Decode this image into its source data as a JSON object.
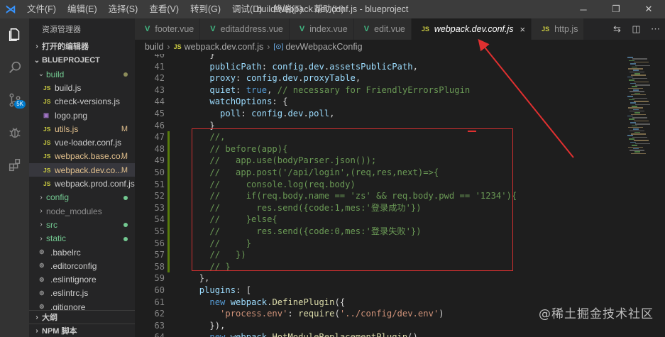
{
  "window": {
    "title": "build\\webpack.dev.conf.js - blueproject",
    "menu": [
      "文件(F)",
      "编辑(E)",
      "选择(S)",
      "查看(V)",
      "转到(G)",
      "调试(D)",
      "终端(T)",
      "帮助(H)"
    ],
    "controls": [
      "─",
      "❐",
      "✕"
    ]
  },
  "activity_bar": {
    "items": [
      "explorer-icon",
      "search-icon",
      "source-control-icon",
      "debug-icon",
      "extensions-icon"
    ],
    "scm_badge": "5K"
  },
  "sidebar": {
    "title": "资源管理器",
    "open_editors": "打开的编辑器",
    "project": "BLUEPROJECT",
    "tree": [
      {
        "name": "build",
        "type": "folder",
        "open": true,
        "depth": 1,
        "status": "dot"
      },
      {
        "name": "build.js",
        "type": "js",
        "depth": 2
      },
      {
        "name": "check-versions.js",
        "type": "js",
        "depth": 2
      },
      {
        "name": "logo.png",
        "type": "png",
        "depth": 2
      },
      {
        "name": "utils.js",
        "type": "js",
        "depth": 2,
        "status": "M"
      },
      {
        "name": "vue-loader.conf.js",
        "type": "js",
        "depth": 2
      },
      {
        "name": "webpack.base.co...",
        "type": "js",
        "depth": 2,
        "status": "M"
      },
      {
        "name": "webpack.dev.co...",
        "type": "js",
        "depth": 2,
        "status": "M",
        "selected": true
      },
      {
        "name": "webpack.prod.conf.js",
        "type": "js",
        "depth": 2
      },
      {
        "name": "config",
        "type": "folder",
        "open": false,
        "depth": 1,
        "status": "dot"
      },
      {
        "name": "node_modules",
        "type": "folder",
        "open": false,
        "depth": 1,
        "dim": true
      },
      {
        "name": "src",
        "type": "folder",
        "open": false,
        "depth": 1,
        "status": "dot"
      },
      {
        "name": "static",
        "type": "folder",
        "open": false,
        "depth": 1,
        "status": "dot"
      },
      {
        "name": ".babelrc",
        "type": "cfg",
        "depth": 1
      },
      {
        "name": ".editorconfig",
        "type": "cfg",
        "depth": 1
      },
      {
        "name": ".eslintignore",
        "type": "cfg",
        "depth": 1
      },
      {
        "name": ".eslintrc.js",
        "type": "cfg",
        "depth": 1
      },
      {
        "name": ".gitignore",
        "type": "cfg",
        "depth": 1
      }
    ],
    "outline": "大纲",
    "npm": "NPM 脚本"
  },
  "tabs": [
    {
      "label": "footer.vue",
      "kind": "vue"
    },
    {
      "label": "editaddress.vue",
      "kind": "vue"
    },
    {
      "label": "index.vue",
      "kind": "vue"
    },
    {
      "label": "edit.vue",
      "kind": "vue"
    },
    {
      "label": "webpack.dev.conf.js",
      "kind": "js",
      "active": true
    },
    {
      "label": "http.js",
      "kind": "js"
    }
  ],
  "breadcrumb": [
    "build",
    "webpack.dev.conf.js",
    "devWebpackConfig"
  ],
  "editor": {
    "lines": [
      {
        "n": "40",
        "html": "    <span class='w'>}</span>"
      },
      {
        "n": "41",
        "html": "    <span class='p'>publicPath</span><span class='w'>: </span><span class='p'>config</span><span class='w'>.</span><span class='p'>dev</span><span class='w'>.</span><span class='p'>assetsPublicPath</span><span class='w'>,</span>"
      },
      {
        "n": "42",
        "html": "    <span class='p'>proxy</span><span class='w'>: </span><span class='p'>config</span><span class='w'>.</span><span class='p'>dev</span><span class='w'>.</span><span class='p'>proxyTable</span><span class='w'>,</span>"
      },
      {
        "n": "43",
        "html": "    <span class='p'>quiet</span><span class='w'>: </span><span class='k'>true</span><span class='w'>, </span><span class='c'>// necessary for FriendlyErrorsPlugin</span>"
      },
      {
        "n": "44",
        "html": "    <span class='p'>watchOptions</span><span class='w'>: {</span>"
      },
      {
        "n": "45",
        "html": "      <span class='p'>poll</span><span class='w'>: </span><span class='p'>config</span><span class='w'>.</span><span class='p'>dev</span><span class='w'>.</span><span class='p'>poll</span><span class='w'>,</span>"
      },
      {
        "n": "46",
        "html": "    <span class='w'>}</span>"
      },
      {
        "n": "47",
        "html": "    <span class='c'>//,</span>",
        "gutter": true
      },
      {
        "n": "48",
        "html": "    <span class='c'>// before(app){</span>",
        "gutter": true
      },
      {
        "n": "49",
        "html": "    <span class='c'>//   app.use(bodyParser.json());</span>",
        "gutter": true
      },
      {
        "n": "50",
        "html": "    <span class='c'>//   app.post('/api/login',(req,res,next)=>{</span>",
        "gutter": true
      },
      {
        "n": "51",
        "html": "    <span class='c'>//     console.log(req.body)</span>",
        "gutter": true
      },
      {
        "n": "52",
        "html": "    <span class='c'>//     if(req.body.name == 'zs' &amp;&amp; req.body.pwd == '1234'){</span>",
        "gutter": true
      },
      {
        "n": "53",
        "html": "    <span class='c'>//       res.send({code:1,mes:'登录成功'})</span>",
        "gutter": true
      },
      {
        "n": "54",
        "html": "    <span class='c'>//     }else{</span>",
        "gutter": true
      },
      {
        "n": "55",
        "html": "    <span class='c'>//       res.send({code:0,mes:'登录失败'})</span>",
        "gutter": true
      },
      {
        "n": "56",
        "html": "    <span class='c'>//     }</span>",
        "gutter": true
      },
      {
        "n": "57",
        "html": "    <span class='c'>//   })</span>",
        "gutter": true
      },
      {
        "n": "58",
        "html": "    <span class='c'>// }</span>",
        "gutter": true
      },
      {
        "n": "59",
        "html": "  <span class='w'>},</span>"
      },
      {
        "n": "60",
        "html": "  <span class='p'>plugins</span><span class='w'>: [</span>"
      },
      {
        "n": "61",
        "html": "    <span class='k'>new</span><span class='w'> </span><span class='p'>webpack</span><span class='w'>.</span><span class='f'>DefinePlugin</span><span class='w'>({</span>"
      },
      {
        "n": "62",
        "html": "      <span class='s'>'process.env'</span><span class='w'>: </span><span class='f'>require</span><span class='w'>(</span><span class='s'>'../config/dev.env'</span><span class='w'>)</span>"
      },
      {
        "n": "63",
        "html": "    <span class='w'>}),</span>"
      },
      {
        "n": "64",
        "html": "    <span class='k'>new</span><span class='w'> </span><span class='p'>webpack</span><span class='w'>.</span><span class='f'>HotModuleReplacementPlugin</span><span class='w'>(),</span>"
      }
    ]
  },
  "watermark": "@稀土掘金技术社区"
}
